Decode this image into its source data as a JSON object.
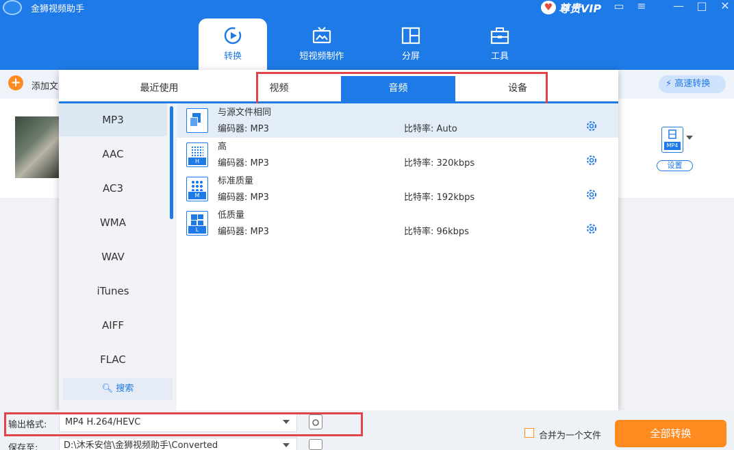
{
  "app": {
    "title": "金狮视频助手",
    "vip_label": "尊贵VIP"
  },
  "nav": [
    {
      "label": "转换",
      "icon": "convert-icon",
      "active": true
    },
    {
      "label": "短视频制作",
      "icon": "tv-icon",
      "active": false
    },
    {
      "label": "分屏",
      "icon": "split-screen-icon",
      "active": false
    },
    {
      "label": "工具",
      "icon": "toolbox-icon",
      "active": false
    }
  ],
  "toolbar": {
    "add_label": "添加文",
    "fast_convert": "高速转换"
  },
  "file": {
    "format_badge": "MP4",
    "settings_label": "设置"
  },
  "popup": {
    "tabs": [
      {
        "label": "最近使用",
        "active": false
      },
      {
        "label": "视频",
        "active": false
      },
      {
        "label": "音频",
        "active": true
      },
      {
        "label": "设备",
        "active": false
      }
    ],
    "formats": [
      "MP3",
      "AAC",
      "AC3",
      "WMA",
      "WAV",
      "iTunes",
      "AIFF",
      "FLAC"
    ],
    "active_format": "MP3",
    "search_label": "搜索",
    "presets": [
      {
        "name": "与源文件相同",
        "codec_label": "编码器:",
        "codec": "MP3",
        "bitrate_label": "比特率:",
        "bitrate": "Auto",
        "badge": "",
        "active": true
      },
      {
        "name": "高",
        "codec_label": "编码器:",
        "codec": "MP3",
        "bitrate_label": "比特率:",
        "bitrate": "320kbps",
        "badge": "H",
        "active": false
      },
      {
        "name": "标准质量",
        "codec_label": "编码器:",
        "codec": "MP3",
        "bitrate_label": "比特率:",
        "bitrate": "192kbps",
        "badge": "M",
        "active": false
      },
      {
        "name": "低质量",
        "codec_label": "编码器:",
        "codec": "MP3",
        "bitrate_label": "比特率:",
        "bitrate": "96kbps",
        "badge": "L",
        "active": false
      }
    ]
  },
  "bottom": {
    "output_label": "输出格式:",
    "output_value": "MP4 H.264/HEVC",
    "save_label": "保存至:",
    "save_path": "D:\\沐禾安信\\金狮视频助手\\Converted",
    "merge_label": "合并为一个文件",
    "convert_all": "全部转换"
  },
  "colors": {
    "accent": "#1e7ae6",
    "orange": "#ff8a1f",
    "highlight": "#e0444a"
  }
}
